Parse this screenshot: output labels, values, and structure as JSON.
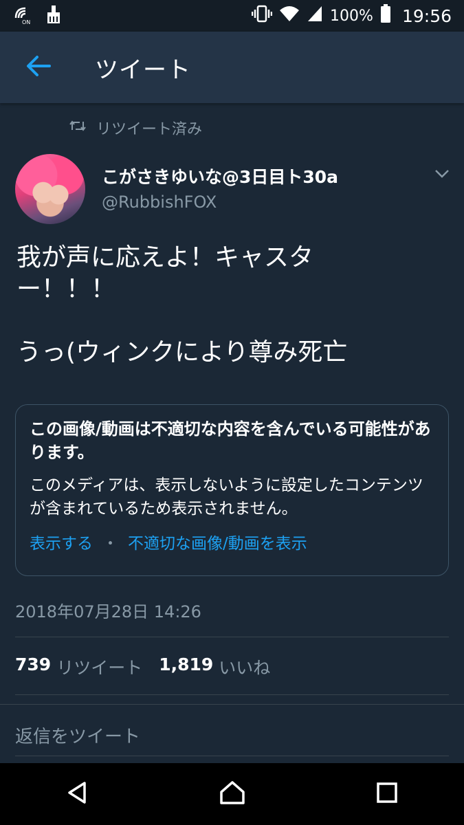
{
  "status_bar": {
    "icons_left": [
      "nfc-on-icon",
      "cleaner-icon"
    ],
    "icons_right": [
      "vibrate-icon",
      "wifi-icon",
      "signal-icon",
      "battery-icon"
    ],
    "battery": "100%",
    "time": "19:56",
    "nfc_label": "ON"
  },
  "header": {
    "title": "ツイート",
    "back_icon": "arrow-left-icon"
  },
  "retweet_context": {
    "label": "リツイート済み",
    "icon": "retweet-icon"
  },
  "author": {
    "name": "こがさきゆいな@3日目ト30a",
    "handle": "@RubbishFOX"
  },
  "tweet": {
    "line1": "我が声に応えよ！キャスタ",
    "line2": "ー！！！",
    "line3": "うっ(ウィンクにより尊み死亡"
  },
  "sensitive_notice": {
    "title": "この画像/動画は不適切な内容を含んでいる可能性があります。",
    "body": "このメディアは、表示しないように設定したコンテンツが含まれているため表示されません。",
    "show_link": "表示する",
    "separator": "・",
    "show_all_link": "不適切な画像/動画を表示"
  },
  "timestamp": "2018年07月28日 14:26",
  "stats": {
    "retweets_count": "739",
    "retweets_label": "リツイート",
    "likes_count": "1,819",
    "likes_label": "いいね"
  },
  "reply": {
    "placeholder": "返信をツイート"
  },
  "colors": {
    "background": "#1b2836",
    "header": "#243447",
    "accent": "#1da1f2",
    "secondary_text": "#8899a6"
  }
}
